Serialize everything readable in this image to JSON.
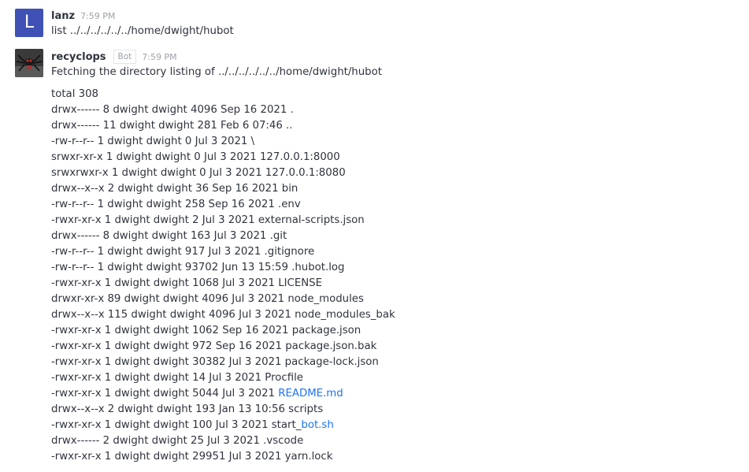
{
  "messages": [
    {
      "avatar_letter": "L",
      "avatar_color": "#3f51b5",
      "username": "lanz",
      "time": "7:59 PM",
      "text": "list ../../../../../../home/dwight/hubot"
    },
    {
      "avatar_icon": "robot-spider-avatar-icon",
      "username": "recyclops",
      "tag": "Bot",
      "time": "7:59 PM",
      "text": "Fetching the directory listing of ../../../../../../home/dwight/hubot"
    }
  ],
  "listing": [
    {
      "text": "total 308"
    },
    {
      "text": "drwx------ 8 dwight dwight 4096 Sep 16 2021 ."
    },
    {
      "text": "drwx------ 11 dwight dwight 281 Feb 6 07:46 .."
    },
    {
      "text": "-rw-r--r-- 1 dwight dwight 0 Jul 3 2021 \\"
    },
    {
      "text": "srwxr-xr-x 1 dwight dwight 0 Jul 3 2021 127.0.0.1:8000"
    },
    {
      "text": "srwxrwxr-x 1 dwight dwight 0 Jul 3 2021 127.0.0.1:8080"
    },
    {
      "text": "drwx--x--x 2 dwight dwight 36 Sep 16 2021 bin"
    },
    {
      "text": "-rw-r--r-- 1 dwight dwight 258 Sep 16 2021 .env"
    },
    {
      "text": "-rwxr-xr-x 1 dwight dwight 2 Jul 3 2021 external-scripts.json"
    },
    {
      "text": "drwx------ 8 dwight dwight 163 Jul 3 2021 .git"
    },
    {
      "text": "-rw-r--r-- 1 dwight dwight 917 Jul 3 2021 .gitignore"
    },
    {
      "text": "-rw-r--r-- 1 dwight dwight 93702 Jun 13 15:59 .hubot.log"
    },
    {
      "text": "-rwxr-xr-x 1 dwight dwight 1068 Jul 3 2021 LICENSE"
    },
    {
      "text": "drwxr-xr-x 89 dwight dwight 4096 Jul 3 2021 node_modules"
    },
    {
      "text": "drwx--x--x 115 dwight dwight 4096 Jul 3 2021 node_modules_bak"
    },
    {
      "text": "-rwxr-xr-x 1 dwight dwight 1062 Sep 16 2021 package.json"
    },
    {
      "text": "-rwxr-xr-x 1 dwight dwight 972 Sep 16 2021 package.json.bak"
    },
    {
      "text": "-rwxr-xr-x 1 dwight dwight 30382 Jul 3 2021 package-lock.json"
    },
    {
      "text": "-rwxr-xr-x 1 dwight dwight 14 Jul 3 2021 Procfile"
    },
    {
      "text": "-rwxr-xr-x 1 dwight dwight 5044 Jul 3 2021 ",
      "link": "README.md"
    },
    {
      "text": "drwx--x--x 2 dwight dwight 193 Jan 13 10:56 scripts"
    },
    {
      "text": "-rwxr-xr-x 1 dwight dwight 100 Jul 3 2021 start_",
      "link": "bot.sh"
    },
    {
      "text": "drwx------ 2 dwight dwight 25 Jul 3 2021 .vscode"
    },
    {
      "text": "-rwxr-xr-x 1 dwight dwight 29951 Jul 3 2021 yarn.lock"
    }
  ],
  "colors": {
    "link": "#1d74f5",
    "text": "#2f343d",
    "muted": "#9ea2a8"
  }
}
